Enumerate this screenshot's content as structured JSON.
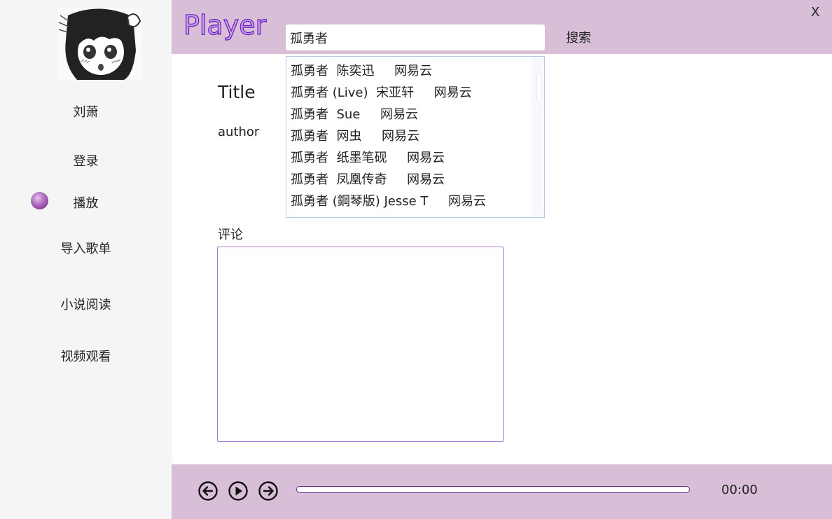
{
  "window": {
    "close_label": "X"
  },
  "sidebar": {
    "avatar_icon": "avatar-icon",
    "user_name": "刘萧",
    "items": [
      {
        "label": "登录"
      },
      {
        "label": "播放",
        "active": true
      },
      {
        "label": "导入歌单"
      },
      {
        "label": "小说阅读"
      },
      {
        "label": "视频观看"
      }
    ]
  },
  "header": {
    "logo": "Player",
    "search_value": "孤勇者",
    "search_label": "搜索"
  },
  "suggestions": [
    "孤勇者  陈奕迅     网易云",
    "孤勇者 (Live)  宋亚轩     网易云",
    "孤勇者  Sue     网易云",
    "孤勇者  网虫     网易云",
    "孤勇者  纸墨笔砚     网易云",
    "孤勇者  凤凰传奇     网易云",
    "孤勇者 (鋼琴版) Jesse T     网易云"
  ],
  "song": {
    "title": "Title",
    "author": "author"
  },
  "comments": {
    "label": "评论",
    "value": ""
  },
  "player": {
    "time": "00:00",
    "progress": 0.0,
    "prev_icon": "prev-arrow-icon",
    "play_icon": "play-icon",
    "next_icon": "next-arrow-icon"
  },
  "colors": {
    "accent": "#d9bed8",
    "logo_stroke": "#6a1fc0",
    "progress": "#6a2a8a"
  }
}
